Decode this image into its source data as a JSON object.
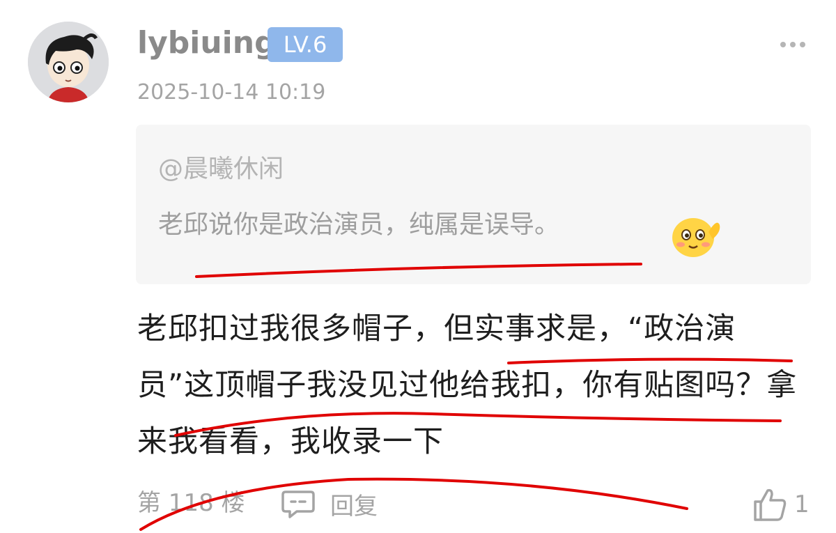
{
  "comment": {
    "username": "lybiuing",
    "level": "LV.6",
    "timestamp": "2025-10-14 10:19",
    "quote": {
      "mention": "@晨曦休闲",
      "text": "老邱说你是政治演员，纯属是误导。",
      "emoji": "shy-smile-emoji"
    },
    "body": "老邱扣过我很多帽子，但实事求是，“政治演员”这顶帽子我没见过他给我扣，你有贴图吗？拿来我看看，我收录一下",
    "footer": {
      "floor": "第 118 楼",
      "reply_label": "回复",
      "like_count": "1"
    }
  },
  "icons": {
    "more": "more-dots-icon",
    "reply": "comment-bubble-icon",
    "like": "thumbs-up-icon"
  },
  "colors": {
    "badge_bg": "#8fb7eb",
    "quote_bg": "#f6f6f6",
    "annotation_red": "#e00000"
  }
}
